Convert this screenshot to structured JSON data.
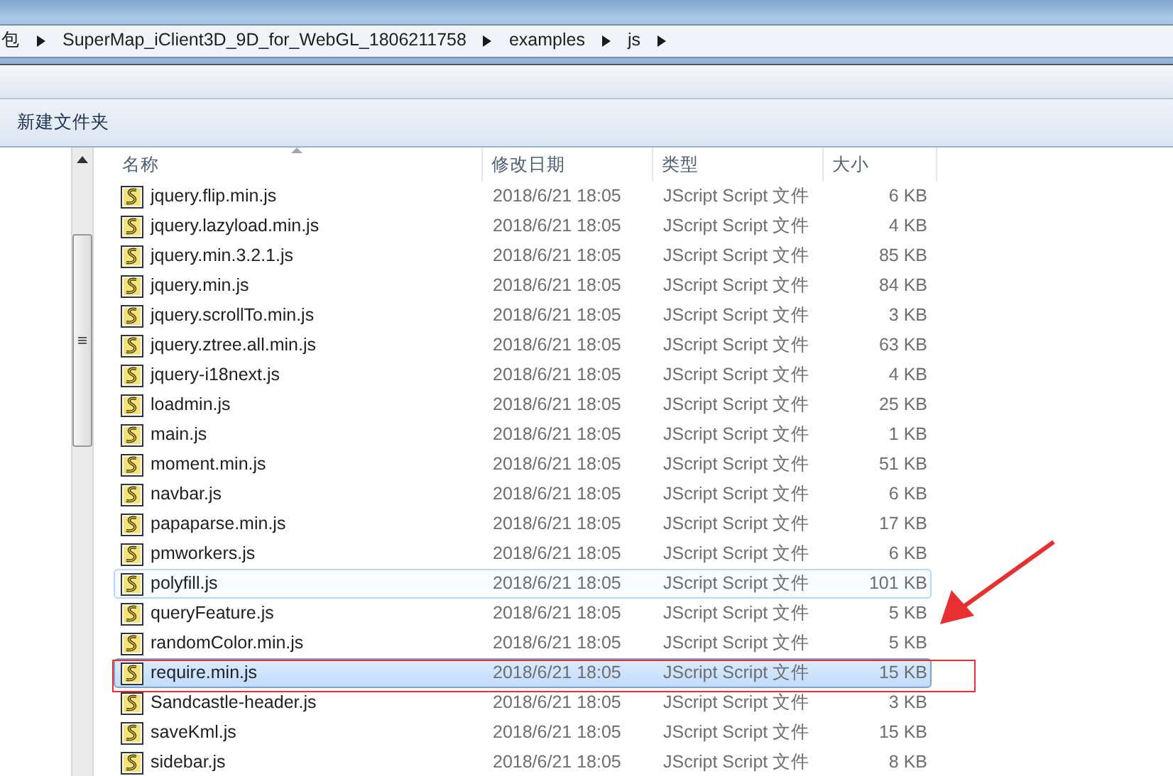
{
  "breadcrumb": [
    "包",
    "SuperMap_iClient3D_9D_for_WebGL_1806211758",
    "examples",
    "js"
  ],
  "toolbar": {
    "new_folder": "新建文件夹"
  },
  "columns": [
    "名称",
    "修改日期",
    "类型",
    "大小"
  ],
  "rows": [
    {
      "name": "jquery.flip.min.js",
      "date": "2018/6/21 18:05",
      "type": "JScript Script 文件",
      "size": "6 KB",
      "selected": false,
      "hovered": false
    },
    {
      "name": "jquery.lazyload.min.js",
      "date": "2018/6/21 18:05",
      "type": "JScript Script 文件",
      "size": "4 KB",
      "selected": false,
      "hovered": false
    },
    {
      "name": "jquery.min.3.2.1.js",
      "date": "2018/6/21 18:05",
      "type": "JScript Script 文件",
      "size": "85 KB",
      "selected": false,
      "hovered": false
    },
    {
      "name": "jquery.min.js",
      "date": "2018/6/21 18:05",
      "type": "JScript Script 文件",
      "size": "84 KB",
      "selected": false,
      "hovered": false
    },
    {
      "name": "jquery.scrollTo.min.js",
      "date": "2018/6/21 18:05",
      "type": "JScript Script 文件",
      "size": "3 KB",
      "selected": false,
      "hovered": false
    },
    {
      "name": "jquery.ztree.all.min.js",
      "date": "2018/6/21 18:05",
      "type": "JScript Script 文件",
      "size": "63 KB",
      "selected": false,
      "hovered": false
    },
    {
      "name": "jquery-i18next.js",
      "date": "2018/6/21 18:05",
      "type": "JScript Script 文件",
      "size": "4 KB",
      "selected": false,
      "hovered": false
    },
    {
      "name": "loadmin.js",
      "date": "2018/6/21 18:05",
      "type": "JScript Script 文件",
      "size": "25 KB",
      "selected": false,
      "hovered": false
    },
    {
      "name": "main.js",
      "date": "2018/6/21 18:05",
      "type": "JScript Script 文件",
      "size": "1 KB",
      "selected": false,
      "hovered": false
    },
    {
      "name": "moment.min.js",
      "date": "2018/6/21 18:05",
      "type": "JScript Script 文件",
      "size": "51 KB",
      "selected": false,
      "hovered": false
    },
    {
      "name": "navbar.js",
      "date": "2018/6/21 18:05",
      "type": "JScript Script 文件",
      "size": "6 KB",
      "selected": false,
      "hovered": false
    },
    {
      "name": "papaparse.min.js",
      "date": "2018/6/21 18:05",
      "type": "JScript Script 文件",
      "size": "17 KB",
      "selected": false,
      "hovered": false
    },
    {
      "name": "pmworkers.js",
      "date": "2018/6/21 18:05",
      "type": "JScript Script 文件",
      "size": "6 KB",
      "selected": false,
      "hovered": false
    },
    {
      "name": "polyfill.js",
      "date": "2018/6/21 18:05",
      "type": "JScript Script 文件",
      "size": "101 KB",
      "selected": false,
      "hovered": true
    },
    {
      "name": "queryFeature.js",
      "date": "2018/6/21 18:05",
      "type": "JScript Script 文件",
      "size": "5 KB",
      "selected": false,
      "hovered": false
    },
    {
      "name": "randomColor.min.js",
      "date": "2018/6/21 18:05",
      "type": "JScript Script 文件",
      "size": "5 KB",
      "selected": false,
      "hovered": false
    },
    {
      "name": "require.min.js",
      "date": "2018/6/21 18:05",
      "type": "JScript Script 文件",
      "size": "15 KB",
      "selected": true,
      "hovered": false
    },
    {
      "name": "Sandcastle-header.js",
      "date": "2018/6/21 18:05",
      "type": "JScript Script 文件",
      "size": "3 KB",
      "selected": false,
      "hovered": false
    },
    {
      "name": "saveKml.js",
      "date": "2018/6/21 18:05",
      "type": "JScript Script 文件",
      "size": "15 KB",
      "selected": false,
      "hovered": false
    },
    {
      "name": "sidebar.js",
      "date": "2018/6/21 18:05",
      "type": "JScript Script 文件",
      "size": "8 KB",
      "selected": false,
      "hovered": false
    }
  ]
}
